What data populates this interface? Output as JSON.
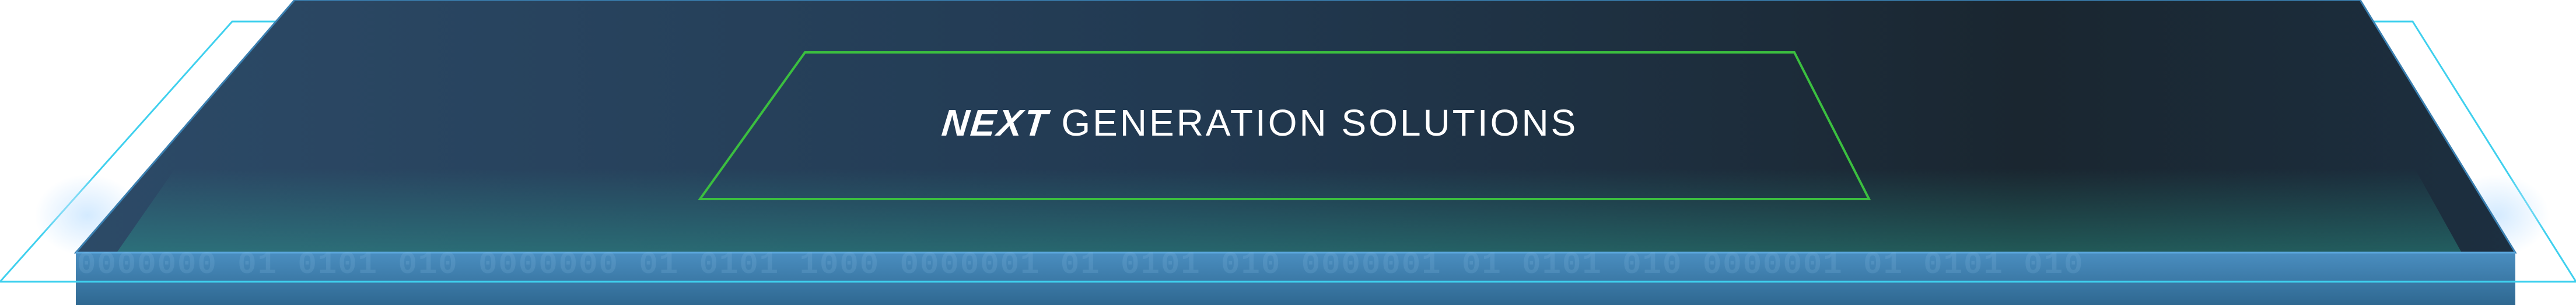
{
  "banner": {
    "headline_part1": "NEXT",
    "headline_part2": "GENERATION SOLUTIONS",
    "binary_pattern": "0000000  01  0101  010    0000000  01  0101  1000    0000001  01  0101  010    0000001  01  0101  010    0000001  01  0101  010"
  },
  "colors": {
    "platform_top_dark": "#1a2630",
    "platform_top_blue": "#2d4a66",
    "platform_front": "#3f7fae",
    "cyan_outline": "#3fd0ee",
    "green_frame": "#3bbf3f",
    "headline_text": "#ffffff"
  }
}
